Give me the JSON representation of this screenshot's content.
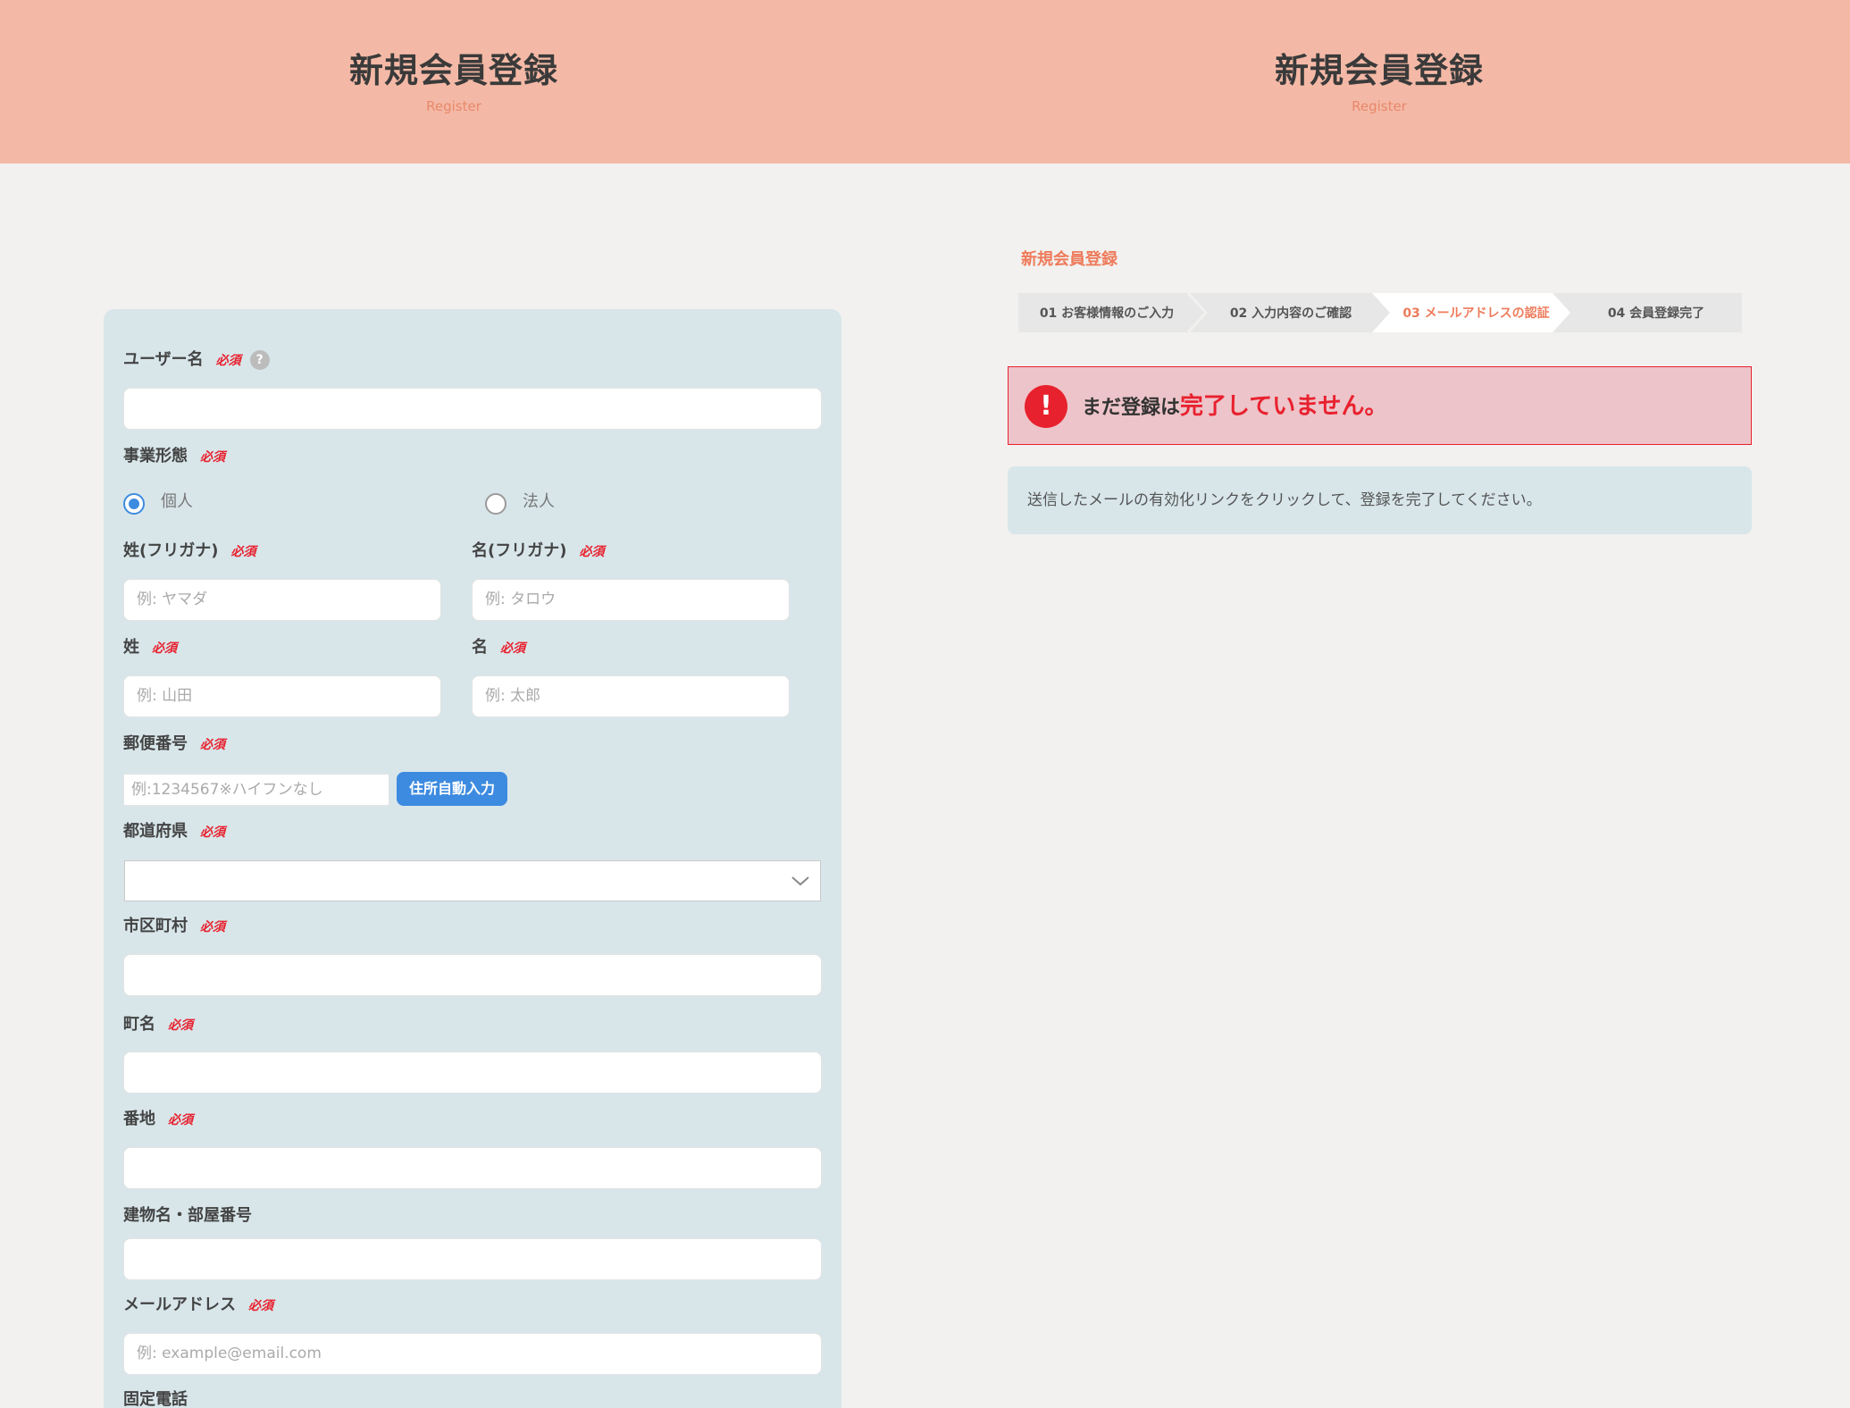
{
  "header": {
    "left": {
      "title": "新規会員登録",
      "subtitle": "Register"
    },
    "right": {
      "title": "新規会員登録",
      "subtitle": "Register"
    }
  },
  "form": {
    "required_mark": "必須",
    "username": {
      "label": "ユーザー名",
      "help": "?",
      "value": ""
    },
    "business_type": {
      "label": "事業形態",
      "options": [
        {
          "label": "個人",
          "selected": true
        },
        {
          "label": "法人",
          "selected": false
        }
      ]
    },
    "last_kana": {
      "label": "姓(フリガナ)",
      "placeholder": "例: ヤマダ"
    },
    "first_kana": {
      "label": "名(フリガナ)",
      "placeholder": "例: タロウ"
    },
    "last_name": {
      "label": "姓",
      "placeholder": "例: 山田"
    },
    "first_name": {
      "label": "名",
      "placeholder": "例: 太郎"
    },
    "postal": {
      "label": "郵便番号",
      "placeholder": "例:1234567※ハイフンなし",
      "button": "住所自動入力"
    },
    "prefecture": {
      "label": "都道府県",
      "value": ""
    },
    "city": {
      "label": "市区町村",
      "value": ""
    },
    "town": {
      "label": "町名",
      "value": ""
    },
    "address_number": {
      "label": "番地",
      "value": ""
    },
    "building": {
      "label": "建物名・部屋番号",
      "value": ""
    },
    "email": {
      "label": "メールアドレス",
      "placeholder": "例: example@email.com"
    },
    "phone": {
      "label": "固定電話"
    }
  },
  "right": {
    "section_title": "新規会員登録",
    "steps": [
      {
        "label": "01 お客様情報のご入力",
        "active": false
      },
      {
        "label": "02 入力内容のご確認",
        "active": false
      },
      {
        "label": "03 メールアドレスの認証",
        "active": true
      },
      {
        "label": "04 会員登録完了",
        "active": false
      }
    ],
    "alert": {
      "icon": "!",
      "text_plain": "まだ登録は",
      "text_emphasis": "完了していません。"
    },
    "info": "送信したメールの有効化リンクをクリックして、登録を完了してください。"
  },
  "colors": {
    "header_bg": "#f4b9a6",
    "accent_orange": "#ee7b5b",
    "required_red": "#e8212e",
    "panel_blue": "#d8e6ea",
    "button_blue": "#3d8be0"
  }
}
